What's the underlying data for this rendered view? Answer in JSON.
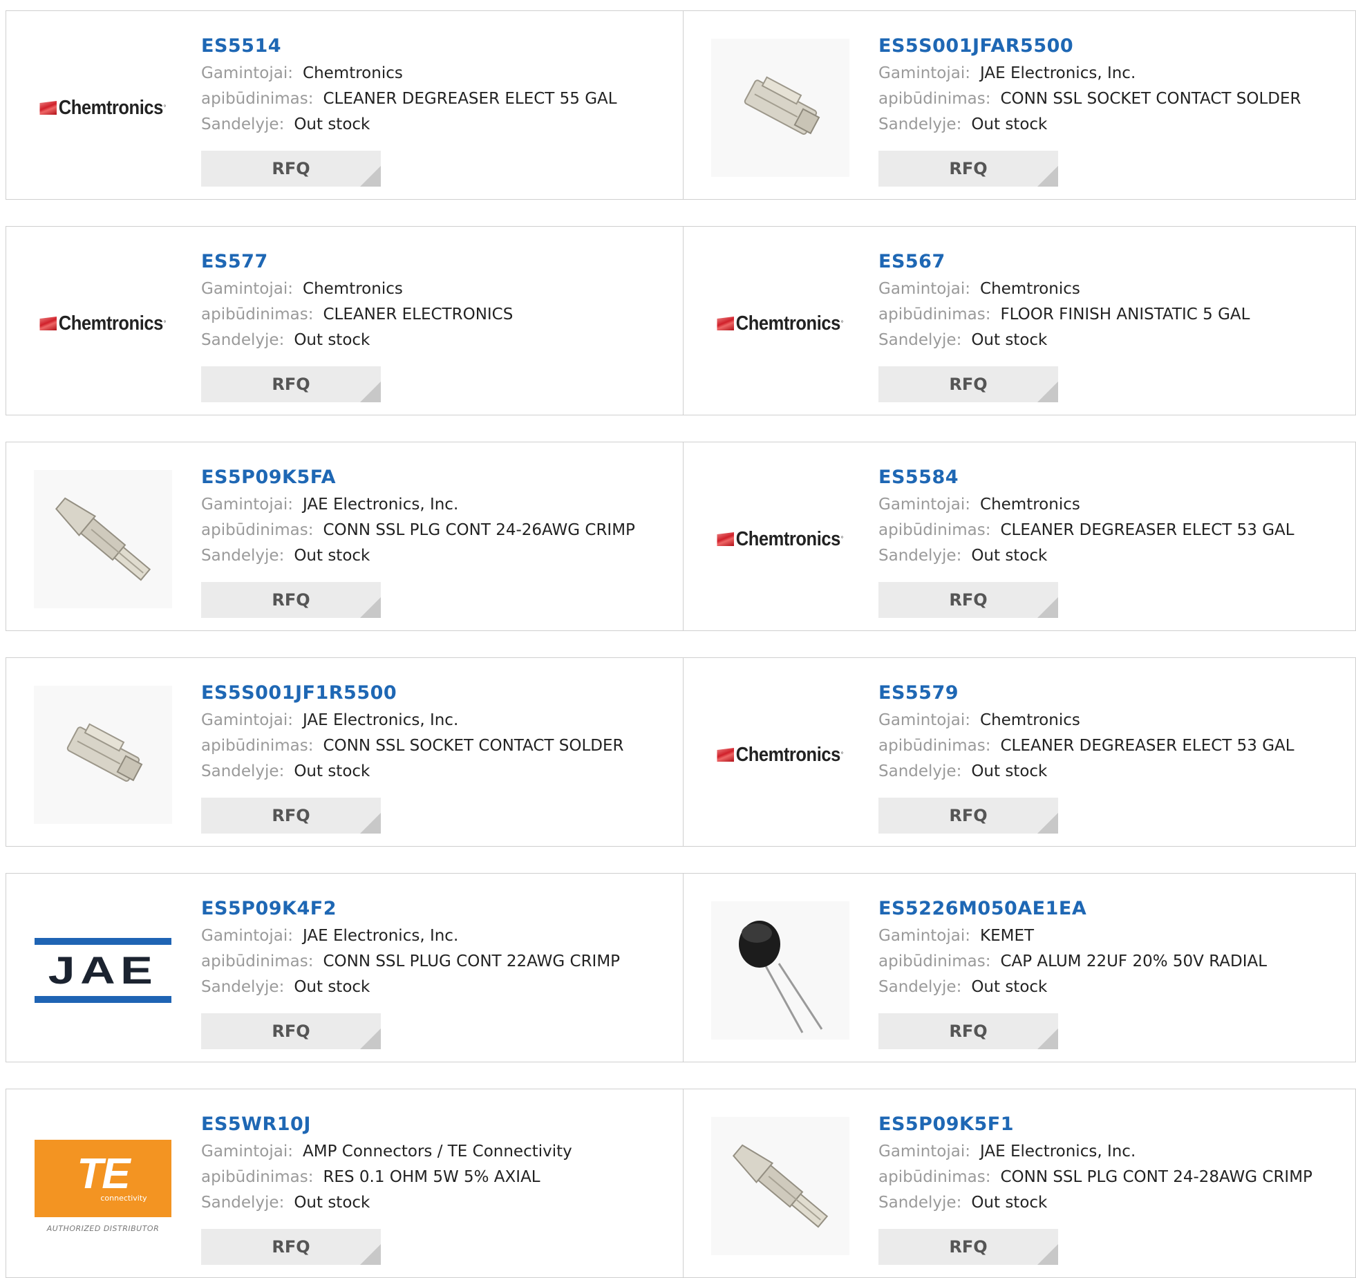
{
  "labels": {
    "manufacturer": "Gamintojai:",
    "description": "apibūdinimas:",
    "stock": "Sandelyje:",
    "rfq": "RFQ"
  },
  "logos": {
    "chemtronics": "Chemtronics",
    "jae": "JAE",
    "te": "TE",
    "te_sub": "connectivity",
    "te_authorized": "AUTHORIZED DISTRIBUTOR"
  },
  "products": [
    {
      "part": "ES5514",
      "manufacturer": "Chemtronics",
      "description": "CLEANER DEGREASER ELECT 55 GAL",
      "stock": "Out stock",
      "image": "chemtronics-logo"
    },
    {
      "part": "ES5S001JFAR5500",
      "manufacturer": "JAE Electronics, Inc.",
      "description": "CONN SSL SOCKET CONTACT SOLDER",
      "stock": "Out stock",
      "image": "socket-contact-photo"
    },
    {
      "part": "ES577",
      "manufacturer": "Chemtronics",
      "description": "CLEANER ELECTRONICS",
      "stock": "Out stock",
      "image": "chemtronics-logo"
    },
    {
      "part": "ES567",
      "manufacturer": "Chemtronics",
      "description": "FLOOR FINISH ANISTATIC 5 GAL",
      "stock": "Out stock",
      "image": "chemtronics-logo"
    },
    {
      "part": "ES5P09K5FA",
      "manufacturer": "JAE Electronics, Inc.",
      "description": "CONN SSL PLG CONT 24-26AWG CRIMP",
      "stock": "Out stock",
      "image": "crimp-contact-photo"
    },
    {
      "part": "ES5584",
      "manufacturer": "Chemtronics",
      "description": "CLEANER DEGREASER ELECT 53 GAL",
      "stock": "Out stock",
      "image": "chemtronics-logo"
    },
    {
      "part": "ES5S001JF1R5500",
      "manufacturer": "JAE Electronics, Inc.",
      "description": "CONN SSL SOCKET CONTACT SOLDER",
      "stock": "Out stock",
      "image": "socket-contact-photo"
    },
    {
      "part": "ES5579",
      "manufacturer": "Chemtronics",
      "description": "CLEANER DEGREASER ELECT 53 GAL",
      "stock": "Out stock",
      "image": "chemtronics-logo"
    },
    {
      "part": "ES5P09K4F2",
      "manufacturer": "JAE Electronics, Inc.",
      "description": "CONN SSL PLUG CONT 22AWG CRIMP",
      "stock": "Out stock",
      "image": "jae-logo"
    },
    {
      "part": "ES5226M050AE1EA",
      "manufacturer": "KEMET",
      "description": "CAP ALUM 22UF 20% 50V RADIAL",
      "stock": "Out stock",
      "image": "capacitor-photo"
    },
    {
      "part": "ES5WR10J",
      "manufacturer": "AMP Connectors / TE Connectivity",
      "description": "RES 0.1 OHM 5W 5% AXIAL",
      "stock": "Out stock",
      "image": "te-logo"
    },
    {
      "part": "ES5P09K5F1",
      "manufacturer": "JAE Electronics, Inc.",
      "description": "CONN SSL PLG CONT 24-28AWG CRIMP",
      "stock": "Out stock",
      "image": "crimp-contact-photo"
    }
  ]
}
